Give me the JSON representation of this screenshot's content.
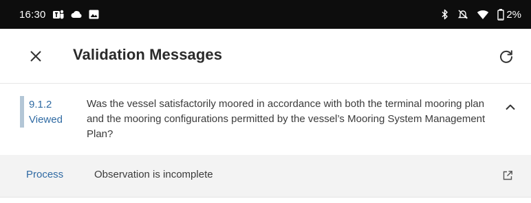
{
  "status_bar": {
    "time": "16:30",
    "battery": "2%",
    "left_icons": [
      "teams-icon",
      "cloud-icon",
      "image-icon"
    ],
    "right_icons": [
      "bluetooth-icon",
      "mute-icon",
      "wifi-icon",
      "battery-icon"
    ]
  },
  "header": {
    "title": "Validation Messages",
    "close_icon": "close-icon",
    "refresh_icon": "refresh-icon"
  },
  "question": {
    "ref": "9.1.2",
    "status": "Viewed",
    "text": "Was the vessel satisfactorily moored in accordance with both the terminal mooring plan and the mooring configurations permitted by the vessel’s Mooring System Management Plan?",
    "expand_icon": "chevron-up-icon"
  },
  "messages": [
    {
      "category": "Process",
      "text": "Observation is incomplete",
      "action_icon": "open-external-icon"
    }
  ],
  "colors": {
    "status_bar_bg": "#0d0d0d",
    "accent": "#2f6aa3",
    "marker": "#b3c6d6",
    "message_bg": "#f3f3f3"
  }
}
